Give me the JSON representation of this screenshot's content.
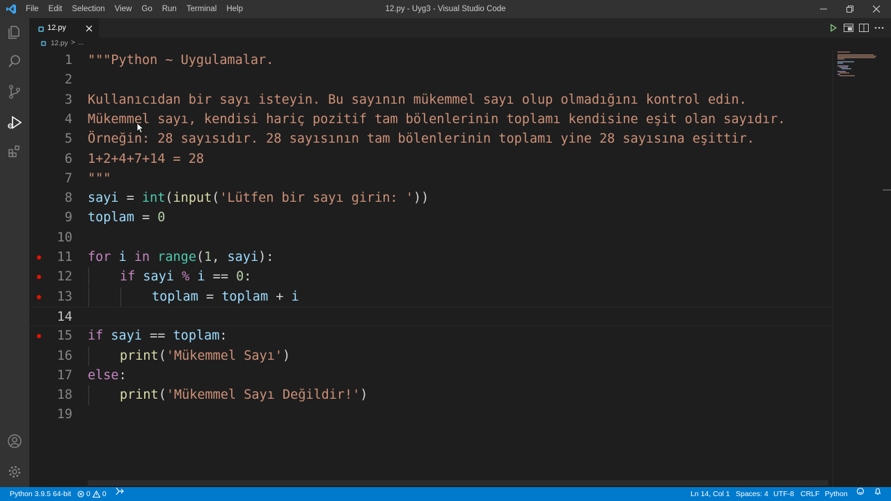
{
  "window": {
    "title": "12.py - Uyg3 - Visual Studio Code",
    "menu": [
      "File",
      "Edit",
      "Selection",
      "View",
      "Go",
      "Run",
      "Terminal",
      "Help"
    ],
    "controls": {
      "minimize_icon": "minimize-icon",
      "maximize_icon": "restore-icon",
      "close_icon": "close-icon"
    }
  },
  "activity_bar": {
    "items": [
      {
        "name": "explorer",
        "icon": "files-icon",
        "active": false
      },
      {
        "name": "search",
        "icon": "search-icon",
        "active": false
      },
      {
        "name": "source-control",
        "icon": "source-control-icon",
        "active": false
      },
      {
        "name": "run-debug",
        "icon": "run-debug-icon",
        "active": true
      },
      {
        "name": "extensions",
        "icon": "extensions-icon",
        "active": false
      }
    ],
    "bottom": [
      {
        "name": "accounts",
        "icon": "account-icon"
      },
      {
        "name": "manage",
        "icon": "gear-icon"
      }
    ]
  },
  "tabs": [
    {
      "label": "12.py",
      "icon": "python-file-icon",
      "active": true
    }
  ],
  "editor_actions": [
    "run-icon",
    "open-preview-icon",
    "split-editor-icon",
    "more-icon"
  ],
  "breadcrumb": {
    "file": "12.py",
    "separator": ">",
    "more": "..."
  },
  "editor": {
    "current_line": 14,
    "breakpoint_lines": [
      11,
      12,
      13,
      15
    ],
    "lines": [
      {
        "n": "1",
        "tokens": [
          [
            "str",
            "\"\"\"Python ~ Uygulamalar."
          ]
        ]
      },
      {
        "n": "2",
        "tokens": []
      },
      {
        "n": "3",
        "tokens": [
          [
            "str",
            "Kullanıcıdan bir sayı isteyin. Bu sayının mükemmel sayı olup olmadığını kontrol edin."
          ]
        ]
      },
      {
        "n": "4",
        "tokens": [
          [
            "str",
            "Mükemmel sayı, kendisi hariç pozitif tam bölenlerinin toplamı kendisine eşit olan sayıdır."
          ]
        ]
      },
      {
        "n": "5",
        "tokens": [
          [
            "str",
            "Örneğin: 28 sayısıdır. 28 sayısının tam bölenlerinin toplamı yine 28 sayısına eşittir."
          ]
        ]
      },
      {
        "n": "6",
        "tokens": [
          [
            "str",
            "1+2+4+7+14 = 28"
          ]
        ]
      },
      {
        "n": "7",
        "tokens": [
          [
            "str",
            "\"\"\""
          ]
        ]
      },
      {
        "n": "8",
        "tokens": [
          [
            "var",
            "sayi"
          ],
          [
            "op",
            " = "
          ],
          [
            "cls",
            "int"
          ],
          [
            "op",
            "("
          ],
          [
            "fn",
            "input"
          ],
          [
            "op",
            "("
          ],
          [
            "str",
            "'Lütfen bir sayı girin: '"
          ],
          [
            "op",
            "))"
          ]
        ]
      },
      {
        "n": "9",
        "tokens": [
          [
            "var",
            "toplam"
          ],
          [
            "op",
            " = "
          ],
          [
            "num",
            "0"
          ]
        ]
      },
      {
        "n": "10",
        "tokens": []
      },
      {
        "n": "11",
        "tokens": [
          [
            "kw",
            "for"
          ],
          [
            "op",
            " "
          ],
          [
            "var",
            "i"
          ],
          [
            "op",
            " "
          ],
          [
            "kw",
            "in"
          ],
          [
            "op",
            " "
          ],
          [
            "cls",
            "range"
          ],
          [
            "op",
            "("
          ],
          [
            "num",
            "1"
          ],
          [
            "op",
            ", "
          ],
          [
            "var",
            "sayi"
          ],
          [
            "op",
            "):"
          ]
        ]
      },
      {
        "n": "12",
        "indent": 1,
        "tokens": [
          [
            "kw",
            "if"
          ],
          [
            "op",
            " "
          ],
          [
            "var",
            "sayi"
          ],
          [
            "op",
            " "
          ],
          [
            "kw",
            "%"
          ],
          [
            "op",
            " "
          ],
          [
            "var",
            "i"
          ],
          [
            "op",
            " == "
          ],
          [
            "num",
            "0"
          ],
          [
            "op",
            ":"
          ]
        ]
      },
      {
        "n": "13",
        "indent": 2,
        "tokens": [
          [
            "var",
            "toplam"
          ],
          [
            "op",
            " = "
          ],
          [
            "var",
            "toplam"
          ],
          [
            "op",
            " + "
          ],
          [
            "var",
            "i"
          ]
        ]
      },
      {
        "n": "14",
        "tokens": []
      },
      {
        "n": "15",
        "tokens": [
          [
            "kw",
            "if"
          ],
          [
            "op",
            " "
          ],
          [
            "var",
            "sayi"
          ],
          [
            "op",
            " == "
          ],
          [
            "var",
            "toplam"
          ],
          [
            "op",
            ":"
          ]
        ]
      },
      {
        "n": "16",
        "indent": 1,
        "tokens": [
          [
            "fn",
            "print"
          ],
          [
            "op",
            "("
          ],
          [
            "str",
            "'Mükemmel Sayı'"
          ],
          [
            "op",
            ")"
          ]
        ]
      },
      {
        "n": "17",
        "tokens": [
          [
            "kw",
            "else"
          ],
          [
            "op",
            ":"
          ]
        ]
      },
      {
        "n": "18",
        "indent": 1,
        "tokens": [
          [
            "fn",
            "print"
          ],
          [
            "op",
            "("
          ],
          [
            "str",
            "'Mükemmel Sayı Değildir!'"
          ],
          [
            "op",
            ")"
          ]
        ]
      },
      {
        "n": "19",
        "tokens": []
      }
    ]
  },
  "status_bar": {
    "interpreter": "Python 3.9.5 64-bit",
    "errors": "0",
    "warnings": "0",
    "position": "Ln 14, Col 1",
    "indentation": "Spaces: 4",
    "encoding": "UTF-8",
    "eol": "CRLF",
    "language": "Python"
  },
  "colors": {
    "statusbar": "#007acc",
    "titlebar": "#323233",
    "activitybar": "#333333",
    "editor_bg": "#1e1e1e",
    "string": "#ce9178",
    "keyword": "#c586c0",
    "variable": "#9cdcfe",
    "function": "#dcdcaa",
    "class": "#4ec9b0",
    "number": "#b5cea8",
    "breakpoint": "#e51400"
  }
}
